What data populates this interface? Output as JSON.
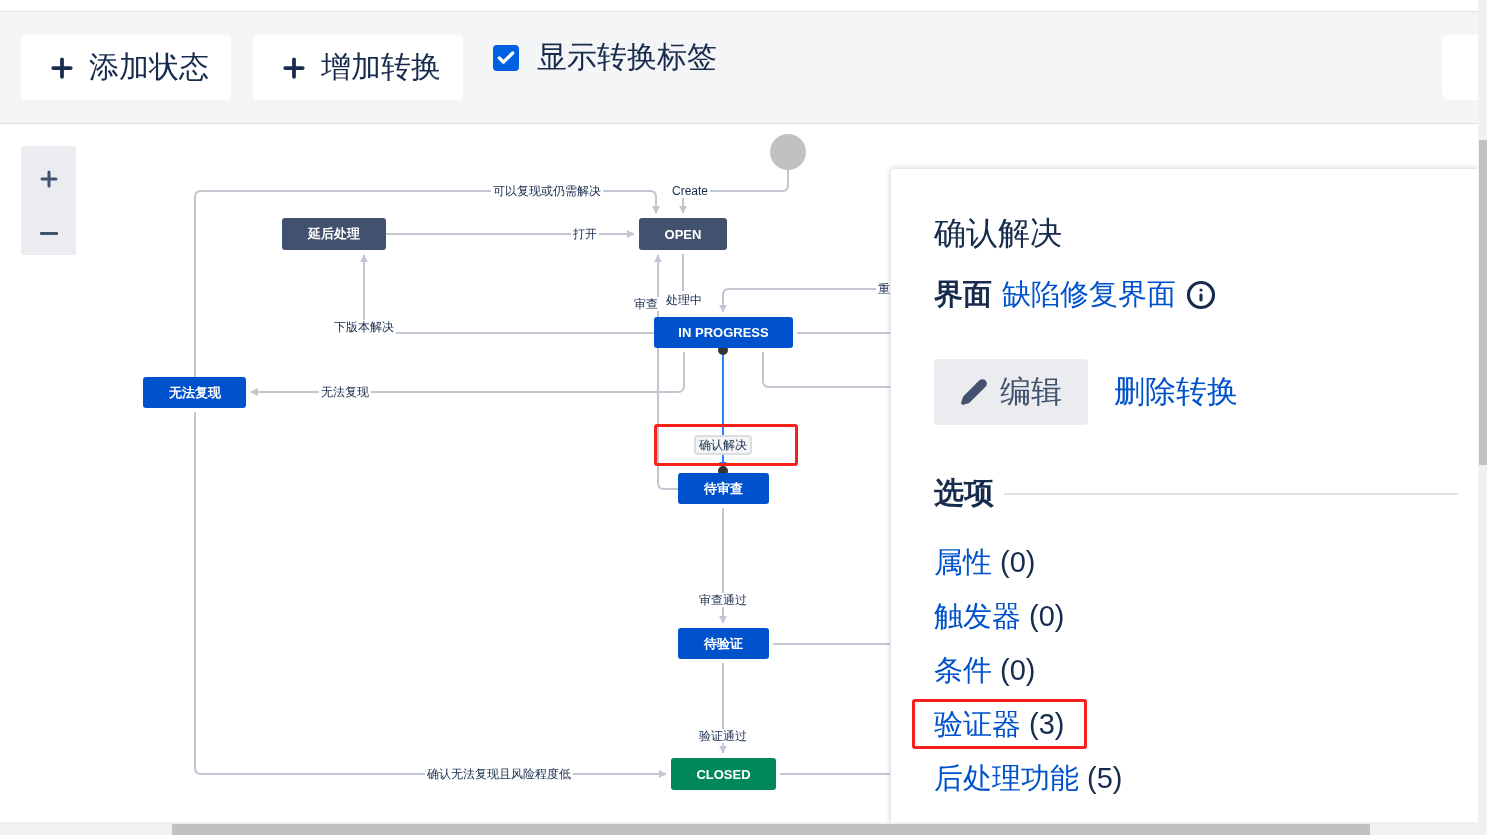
{
  "toolbar": {
    "buttons": [
      {
        "label": "添加状态"
      },
      {
        "label": "增加转换"
      }
    ],
    "show_labels": {
      "label": "显示转换标签",
      "checked": true
    }
  },
  "diagram": {
    "nodes": [
      {
        "label": "延后处理",
        "kind": "todo"
      },
      {
        "label": "OPEN",
        "kind": "todo"
      },
      {
        "label": "IN PROGRESS",
        "kind": "progress"
      },
      {
        "label": "无法复现",
        "kind": "progress"
      },
      {
        "label": "待审查",
        "kind": "progress"
      },
      {
        "label": "待验证",
        "kind": "progress"
      },
      {
        "label": "CLOSED",
        "kind": "done"
      }
    ],
    "transitions": [
      {
        "label": "可以复现或仍需解决",
        "selected": false,
        "highlighted": false
      },
      {
        "label": "Create",
        "selected": false,
        "highlighted": false
      },
      {
        "label": "打开",
        "selected": false,
        "highlighted": false
      },
      {
        "label": "审查",
        "selected": false,
        "highlighted": false
      },
      {
        "label": "处理中",
        "selected": false,
        "highlighted": false
      },
      {
        "label": "重",
        "selected": false,
        "highlighted": false
      },
      {
        "label": "下版本解决",
        "selected": false,
        "highlighted": false
      },
      {
        "label": "无法复现",
        "selected": false,
        "highlighted": false
      },
      {
        "label": "确认解决",
        "selected": true,
        "highlighted": true
      },
      {
        "label": "审查通过",
        "selected": false,
        "highlighted": false
      },
      {
        "label": "验证通过",
        "selected": false,
        "highlighted": false
      },
      {
        "label": "确认无法复现且风险程度低",
        "selected": false,
        "highlighted": false
      }
    ]
  },
  "panel": {
    "title": "确认解决",
    "screen": {
      "label": "界面",
      "value": "缺陷修复界面"
    },
    "actions": [
      {
        "label": "编辑",
        "kind": "button"
      },
      {
        "label": "删除转换",
        "kind": "link"
      }
    ],
    "section": "选项",
    "options": [
      {
        "label": "属性",
        "count": "(0)",
        "highlighted": false
      },
      {
        "label": "触发器",
        "count": "(0)",
        "highlighted": false
      },
      {
        "label": "条件",
        "count": "(0)",
        "highlighted": false
      },
      {
        "label": "验证器",
        "count": "(3)",
        "highlighted": true
      },
      {
        "label": "后处理功能",
        "count": "(5)",
        "highlighted": false
      }
    ]
  }
}
